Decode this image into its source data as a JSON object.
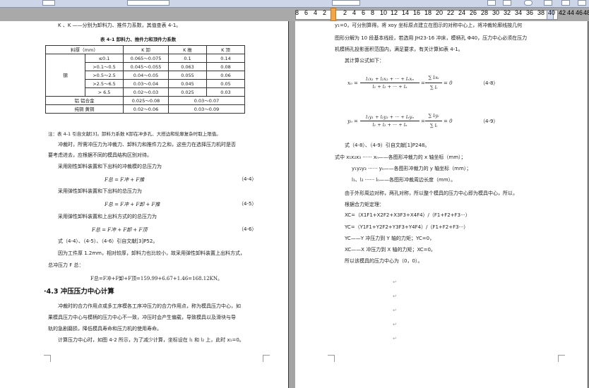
{
  "ruler": {
    "numbers": [
      "8",
      "6",
      "4",
      "2",
      "2",
      "4",
      "6",
      "8",
      "10",
      "12",
      "14",
      "16",
      "18",
      "20",
      "22",
      "24",
      "26",
      "28",
      "30",
      "32",
      "34",
      "36",
      "38",
      "40",
      "42",
      "44",
      "46",
      "48"
    ]
  },
  "left": {
    "intro": "K  、K   ——分别为卸料力、推件力系数，其值查表 4-1。",
    "table_title": "表 4-1  卸料力、推件力和顶件力系数",
    "table": {
      "headers": [
        "料厚（mm）",
        "K 卸",
        "K 推",
        "K 顶"
      ],
      "group_label": "钢",
      "rows": [
        [
          "≤0.1",
          "0.065～0.075",
          "0.1",
          "0.14"
        ],
        [
          ">0.1～0.5",
          "0.045～0.055",
          "0.063",
          "0.08"
        ],
        [
          ">0.5～2.5",
          "0.04～0.05",
          "0.055",
          "0.06"
        ],
        [
          ">2.5～6.5",
          "0.03～0.04",
          "0.045",
          "0.05"
        ],
        [
          "> 6.5",
          "0.02～0.03",
          "0.025",
          "0.03"
        ]
      ],
      "extra_rows": [
        [
          "铝  铝合金",
          "0.025～0.08",
          "0.03～0.07"
        ],
        [
          "纯铜  黄铜",
          "0.02～0.06",
          "0.03～0.09"
        ]
      ]
    },
    "note": "注：表 4-1 引自文献[3]。卸料力系数 K卸在冲多孔、大搭边和轮廓复杂时取上限值。",
    "p1": "冲裁时，所需冲压力为冲裁力、卸料力和推件力之和，这些力在选择压力机时是否",
    "p1b": "要考虑进去，应根据不同的模具结构区别对待。",
    "p2": "采用刚性卸料装置和下出料的冲裁模的总压力为",
    "eq1": "F总 = F冲 + F推",
    "eq1_num": "（4-4）",
    "p3": "采用弹性卸料装置和下出料的总压力为",
    "eq2": "F总 = F冲 + F卸 + F推",
    "eq2_num": "（4-5）",
    "p4": "采用弹性卸料装置和上出料方式的的总压力为",
    "eq3": "F总 = F冲 + F卸 + F顶",
    "eq3_num": "（4-6）",
    "p5": "式（4-4）、（4-5）、（4-6）引自文献[3]P52。",
    "p6": "因为工件厚 1.2mm，相对较厚，卸料力也比较小，故采用弹性卸料装置上出料方式，",
    "p6b": "总冲压力 F 总：",
    "eq4": "F总=F冲+F卸+F顶=159.99+6.67+1.46=168.12KN。",
    "heading": "·4.3 冲压压力中心计算",
    "p7": "冲裁时的合力作用点或多工序模各工序冲压力的合力作用点，称为模具压力中心，如",
    "p7b": "果模具压力中心与模柄的压力中心不一致，冲压时会产生偏载，导致模具以及滑块与导",
    "p7c": "轨的急剧磨损，降低模具寿命和压力机的使用寿命。",
    "p8": "计算压力中心时，如图 4-2 所示，为了减少计算，坐标设在 l₁ 和 l₂ 上，此时 x₁=0。"
  },
  "right": {
    "r1": "y₁=0，可分别算得。将 xoy 坐标原点建立在图示的对称中心上，将冲裁轮廓线按几何",
    "r2": "图形分解为 10 段基本线段，若选用 JH23-16 冲床，模柄孔 Φ40，压力中心必须在压力",
    "r3": "机模柄孔投影面积范围内，满足要求，有关计算如表 4-1。",
    "r4": "其计算公式如下：",
    "eq_x_left": "x₀ =",
    "eq_x_num": "l₁x₁ + l₂x₂ + ··· + lₙxₙ",
    "eq_x_den": "l₁ + l₂ + ··· + lₙ",
    "eq_x_sum_num": "∑ lᵢxᵢ",
    "eq_x_sum_den": "∑ lᵢ",
    "eq_x_eq": "= 0",
    "eq_x_tag": "（4-8）",
    "eq_y_left": "y₀ =",
    "eq_y_num": "l₁y₁ + l₂y₂ + ··· + lₙyₙ",
    "eq_y_den": "l₁ + l₂ + ··· + lₙ",
    "eq_y_sum_num": "∑ lᵢyᵢ",
    "eq_y_sum_den": "∑ lᵢ",
    "eq_y_eq": "= 0",
    "eq_y_tag": "（4-9）",
    "r5": "式（4-8）、（4-9）引自文献[1]P248。",
    "r6": "式中  x₁x₂x₃ ······ xₙ——各图形冲裁力的 x 轴坐标（mm）；",
    "r7": "y₁y₂y₃ ······ yₙ——各图形冲裁力的 y 轴坐标（mm）；",
    "r8": "l₁、l₂ ······ lₙ——各图形冲裁周边长度（mm）。",
    "r9": "由于外形周边对称，两孔对称，所以整个模具的压力中心即为模具中心，所以，",
    "r10": "根据合力矩定理：",
    "r11": "XC=（X1F1+X2F2+X3F3+X4F4）/（F1+F2+F3···）",
    "r12": "YC=（Y1F1+Y2F2+Y3F3+Y4F4）/（F1+F2+F3···）",
    "r13": "YC——Y 冲压力到 Y 轴的力矩；YC=0，",
    "r14": "XC——X 冲压力到 X 轴的力矩；XC=0。",
    "r15": "所以该模具的压力中心为（0，0）。"
  }
}
